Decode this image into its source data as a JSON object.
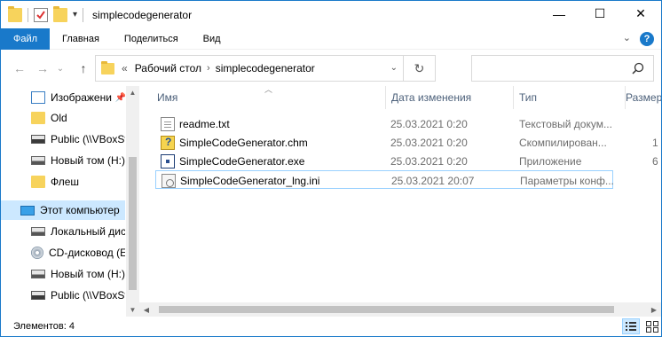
{
  "window": {
    "title": "simplecodegenerator"
  },
  "titlebar": {
    "minimize": "—",
    "maximize": "☐",
    "close": "✕"
  },
  "ribbon": {
    "tabs": [
      "Файл",
      "Главная",
      "Поделиться",
      "Вид"
    ],
    "collapse": "⌄",
    "help": "?"
  },
  "address": {
    "prefix": "«",
    "crumbs": [
      "Рабочий стол",
      "simplecodegenerator"
    ],
    "chevron": "›",
    "dropdown": "⌄",
    "refresh": "↻"
  },
  "nav_buttons": {
    "back": "←",
    "forward": "→",
    "recent": "⌄",
    "up": "↑"
  },
  "search": {
    "icon": "🔍"
  },
  "sidebar": {
    "items": [
      {
        "label": "Изображени",
        "icon": "pictures-icon",
        "pinned": true
      },
      {
        "label": "Old",
        "icon": "folder-icon"
      },
      {
        "label": "Public (\\\\VBoxSv",
        "icon": "network-drive-icon"
      },
      {
        "label": "Новый том (H:)",
        "icon": "drive-icon"
      },
      {
        "label": "Флеш",
        "icon": "folder-icon"
      },
      {
        "label": "Этот компьютер",
        "icon": "computer-icon",
        "selected": true
      },
      {
        "label": "Локальный дис",
        "icon": "drive-icon"
      },
      {
        "label": "CD-дисковод (E",
        "icon": "cd-drive-icon"
      },
      {
        "label": "Новый том (H:)",
        "icon": "drive-icon"
      },
      {
        "label": "Public (\\\\VBoxSv",
        "icon": "network-drive-icon"
      }
    ]
  },
  "columns": {
    "name": "Имя",
    "date": "Дата изменения",
    "type": "Тип",
    "size": "Размер"
  },
  "files": [
    {
      "name": "readme.txt",
      "date": "25.03.2021 0:20",
      "type": "Текстовый докум...",
      "size": "",
      "icon": "text-file-icon"
    },
    {
      "name": "SimpleCodeGenerator.chm",
      "date": "25.03.2021 0:20",
      "type": "Скомпилирован...",
      "size": "1",
      "icon": "chm-file-icon"
    },
    {
      "name": "SimpleCodeGenerator.exe",
      "date": "25.03.2021 0:20",
      "type": "Приложение",
      "size": "6",
      "icon": "exe-file-icon"
    },
    {
      "name": "SimpleCodeGenerator_lng.ini",
      "date": "25.03.2021 20:07",
      "type": "Параметры конф...",
      "size": "",
      "icon": "ini-file-icon"
    }
  ],
  "status": {
    "text": "Элементов: 4"
  }
}
